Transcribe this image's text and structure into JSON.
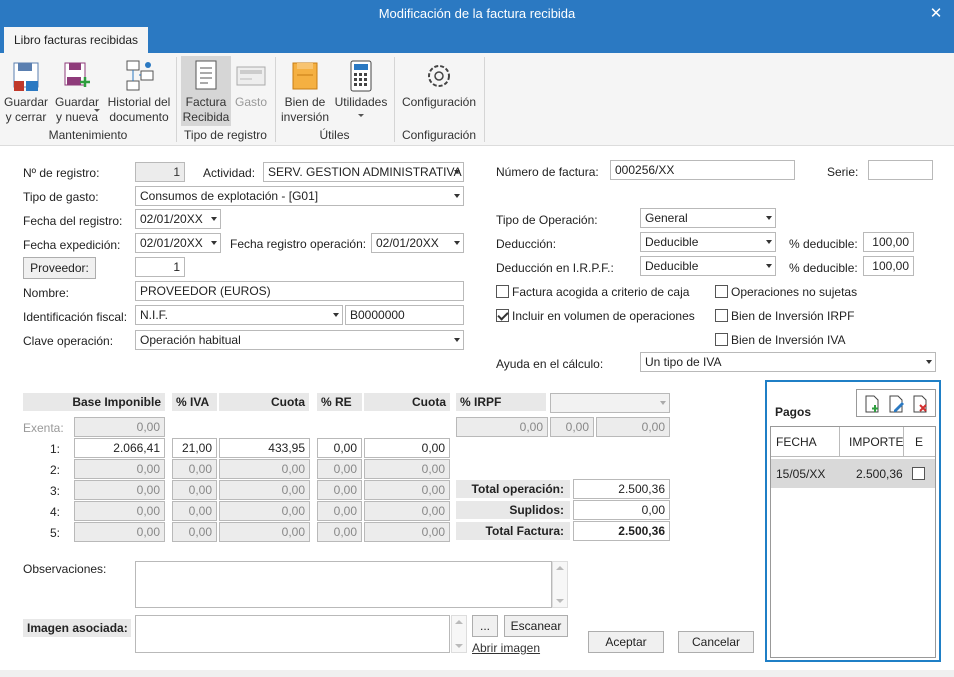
{
  "window": {
    "title": "Modificación de la factura recibida",
    "close": "✕"
  },
  "ribbon": {
    "tab": "Libro facturas recibidas",
    "buttons": {
      "guardar_cerrar": "Guardar\ny cerrar",
      "guardar_nueva": "Guardar\ny nueva",
      "historial": "Historial del\ndocumento",
      "factura_recibida": "Factura\nRecibida",
      "gasto": "Gasto",
      "bien_inversion": "Bien de\ninversión",
      "utilidades": "Utilidades",
      "configuracion": "Configuración"
    },
    "groups": {
      "mantenimiento": "Mantenimiento",
      "tipo_registro": "Tipo de registro",
      "utiles": "Útiles",
      "configuracion": "Configuración"
    }
  },
  "form": {
    "n_registro_label": "Nº de registro:",
    "n_registro": "1",
    "actividad_label": "Actividad:",
    "actividad": "SERV. GESTION ADMINISTRATIVA",
    "tipo_gasto_label": "Tipo de gasto:",
    "tipo_gasto": "Consumos de explotación - [G01]",
    "fecha_registro_label": "Fecha del registro:",
    "fecha_registro": "02/01/20XX",
    "fecha_expedicion_label": "Fecha expedición:",
    "fecha_expedicion": "02/01/20XX",
    "fecha_reg_op_label": "Fecha registro operación:",
    "fecha_reg_op": "02/01/20XX",
    "proveedor_button": "Proveedor:",
    "proveedor": "1",
    "nombre_label": "Nombre:",
    "nombre": "PROVEEDOR (EUROS)",
    "id_fiscal_label": "Identificación fiscal:",
    "id_fiscal_tipo": "N.I.F.",
    "id_fiscal": "B0000000",
    "clave_op_label": "Clave operación:",
    "clave_op": "Operación habitual",
    "numero_factura_label": "Número de factura:",
    "numero_factura": "000256/XX",
    "serie_label": "Serie:",
    "serie": "",
    "tipo_operacion_label": "Tipo de Operación:",
    "tipo_operacion": "General",
    "deduccion_label": "Deducción:",
    "deduccion": "Deducible",
    "pct_deducible_label": "% deducible:",
    "pct_deducible": "100,00",
    "deduccion_irpf_label": "Deducción en I.R.P.F.:",
    "deduccion_irpf": "Deducible",
    "pct_deducible_irpf": "100,00",
    "chk_caja": "Factura acogida a criterio de caja",
    "chk_no_sujetas": "Operaciones no sujetas",
    "chk_volumen": "Incluir en  volumen de operaciones",
    "chk_bien_irpf": "Bien de Inversión IRPF",
    "chk_bien_iva": "Bien de Inversión IVA",
    "ayuda_label": "Ayuda en el cálculo:",
    "ayuda": "Un tipo de IVA"
  },
  "tax_table": {
    "headers": [
      "Base Imponible",
      "% IVA",
      "Cuota",
      "% RE",
      "Cuota"
    ],
    "exenta_label": "Exenta:",
    "exenta": "0,00",
    "rows": [
      {
        "label": "1:",
        "base": "2.066,41",
        "iva": "21,00",
        "cuota": "433,95",
        "re": "0,00",
        "cuota_re": "0,00"
      },
      {
        "label": "2:",
        "base": "0,00",
        "iva": "0,00",
        "cuota": "0,00",
        "re": "0,00",
        "cuota_re": "0,00"
      },
      {
        "label": "3:",
        "base": "0,00",
        "iva": "0,00",
        "cuota": "0,00",
        "re": "0,00",
        "cuota_re": "0,00"
      },
      {
        "label": "4:",
        "base": "0,00",
        "iva": "0,00",
        "cuota": "0,00",
        "re": "0,00",
        "cuota_re": "0,00"
      },
      {
        "label": "5:",
        "base": "0,00",
        "iva": "0,00",
        "cuota": "0,00",
        "re": "0,00",
        "cuota_re": "0,00"
      }
    ],
    "irpf_label": "% IRPF",
    "irpf_select": "",
    "irpf_a": "0,00",
    "irpf_b": "0,00",
    "irpf_c": "0,00"
  },
  "totals": {
    "total_operacion_label": "Total operación:",
    "total_operacion": "2.500,36",
    "suplidos_label": "Suplidos:",
    "suplidos": "0,00",
    "total_factura_label": "Total Factura:",
    "total_factura": "2.500,36"
  },
  "pagos": {
    "title": "Pagos",
    "headers": [
      "FECHA",
      "IMPORTE",
      "E"
    ],
    "rows": [
      {
        "fecha": "15/05/XX",
        "importe": "2.500,36"
      }
    ]
  },
  "bottom": {
    "observaciones_label": "Observaciones:",
    "imagen_label": "Imagen asociada:",
    "browse": "...",
    "escanear": "Escanear",
    "abrir_imagen": "Abrir imagen",
    "aceptar": "Aceptar",
    "cancelar": "Cancelar"
  },
  "colors": {
    "title_bar": "#2b79c2",
    "pagos_border": "#1f7fc6"
  }
}
